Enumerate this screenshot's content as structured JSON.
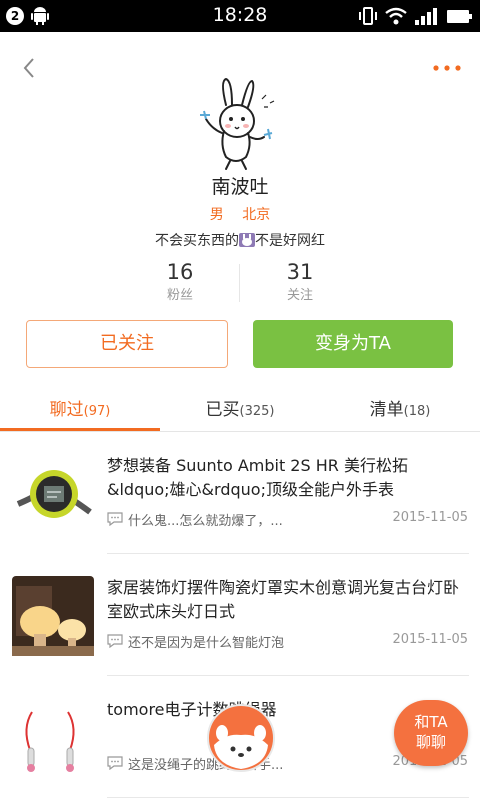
{
  "status_bar": {
    "time": "18:28",
    "notification_count": "2"
  },
  "profile": {
    "name": "南波吐",
    "gender": "男",
    "city": "北京",
    "bio_before": "不会买东西的",
    "bio_after": "不是好网红",
    "stats": [
      {
        "value": "16",
        "label": "粉丝"
      },
      {
        "value": "31",
        "label": "关注"
      }
    ]
  },
  "actions": {
    "follow_label": "已关注",
    "become_label": "变身为TA"
  },
  "tabs": [
    {
      "label": "聊过",
      "count": "(97)",
      "active": true
    },
    {
      "label": "已买",
      "count": "(325)",
      "active": false
    },
    {
      "label": "清单",
      "count": "(18)",
      "active": false
    }
  ],
  "items": [
    {
      "title": "梦想装备 Suunto Ambit 2S HR 美行松拓&ldquo;雄心&rdquo;顶级全能户外手表",
      "comment": "什么鬼...怎么就劲爆了，...",
      "date": "2015-11-05",
      "thumb_icon": "watch-icon"
    },
    {
      "title": "家居装饰灯摆件陶瓷灯罩实木创意调光复古台灯卧室欧式床头灯日式",
      "comment": "还不是因为是什么智能灯泡",
      "date": "2015-11-05",
      "thumb_icon": "lamp-icon"
    },
    {
      "title": "tomore电子计数跳绳器",
      "comment": "这是没绳子的跳绳，抖手...",
      "date": "2015-11-05",
      "thumb_icon": "jump-rope-icon"
    }
  ],
  "fab": {
    "line1": "和TA",
    "line2": "聊聊"
  },
  "colors": {
    "accent": "#f26b21",
    "green": "#7ac142",
    "fab": "#f4713f"
  }
}
